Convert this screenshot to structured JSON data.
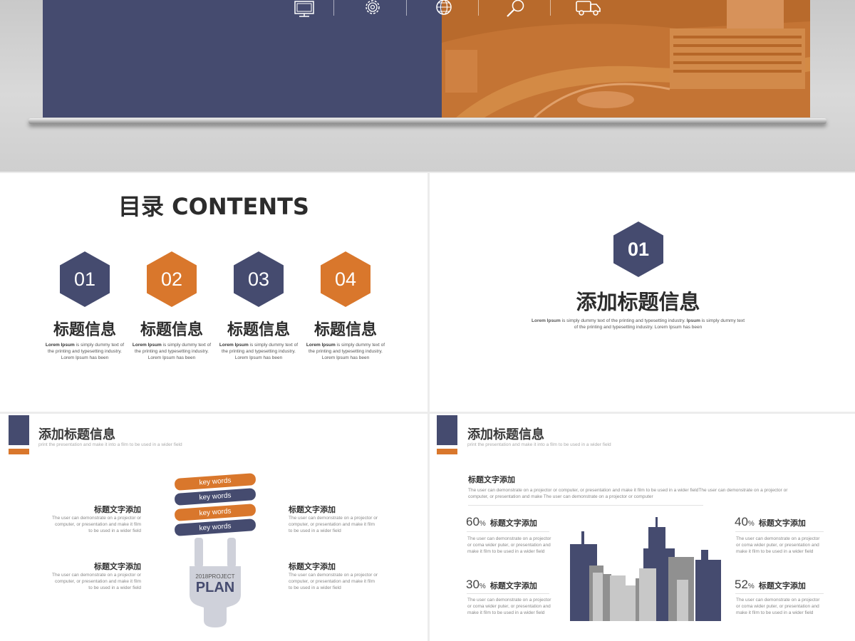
{
  "colors": {
    "navy": "#454b6f",
    "orange": "#d9772c"
  },
  "top_icons": [
    "monitor-icon",
    "gear-icon",
    "globe-icon",
    "magnifier-icon",
    "truck-icon"
  ],
  "contents": {
    "title": "目录 CONTENTS",
    "items": [
      {
        "num": "01",
        "title": "标题信息",
        "desc_bold": "Lorem Ipsum",
        "desc": " is simply dummy text of the printing and typesetting industry. Lorem Ipsum has been"
      },
      {
        "num": "02",
        "title": "标题信息",
        "desc_bold": "Lorem Ipsum",
        "desc": " is simply dummy text of the printing and typesetting industry. Lorem Ipsum has been"
      },
      {
        "num": "03",
        "title": "标题信息",
        "desc_bold": "Lorem Ipsum",
        "desc": " is simply dummy text of the printing and typesetting industry. Lorem Ipsum has been"
      },
      {
        "num": "04",
        "title": "标题信息",
        "desc_bold": "Lorem Ipsum",
        "desc": " is simply dummy text of the printing and typesetting industry. Lorem Ipsum has been"
      }
    ]
  },
  "section": {
    "num": "01",
    "title": "添加标题信息",
    "desc_bold1": "Lorem Ipsum",
    "desc1": " is simply dummy text of the printing and typesetting industry. ",
    "desc_bold2": "Ipsum",
    "desc2": " is simply dummy text of the printing and typesetting industry. Lorem Ipsum has been"
  },
  "slide4": {
    "title": "添加标题信息",
    "subtitle": "print the presentation and make it into a film to be used in a wider field",
    "keywords": [
      "key words",
      "key words",
      "key words",
      "key words"
    ],
    "bulb_year": "2018PROJECT",
    "bulb_plan": "PLAN",
    "blocks": [
      {
        "title": "标题文字添加",
        "text": "The user can demonstrate on a projector or computer, or presentation and make it film to be used in a wider field"
      },
      {
        "title": "标题文字添加",
        "text": "The user can demonstrate on a projector or computer, or presentation and make it film to be used in a wider field"
      },
      {
        "title": "标题文字添加",
        "text": "The user can demonstrate on a projector or computer, or presentation and make it film to be used in a wider field"
      },
      {
        "title": "标题文字添加",
        "text": "The user can demonstrate on a projector or computer, or presentation and make it film to be used in a wider field"
      }
    ]
  },
  "slide5": {
    "title": "添加标题信息",
    "subtitle": "print the presentation and make it into a film to be used in a wider field",
    "lead_title": "标题文字添加",
    "lead_text": "The user can demonstrate on a projector or computer, or presentation and make it film to be used in a wider fieldThe user can demonstrate on a projector or computer, or presentation and make The user can demonstrate on a projector or computer",
    "stats": [
      {
        "value": "60",
        "unit": "%",
        "title": "标题文字添加",
        "text": "The user can demonstrate on a projector or coma wider puter, or presentation and make it film to be used in a wider field"
      },
      {
        "value": "30",
        "unit": "%",
        "title": "标题文字添加",
        "text": "The user can demonstrate on a projector or coma wider puter, or presentation and make it film to be used in a wider field"
      },
      {
        "value": "40",
        "unit": "%",
        "title": "标题文字添加",
        "text": "The user can demonstrate on a projector or coma wider puter, or presentation and make it film to be used in a wider field"
      },
      {
        "value": "52",
        "unit": "%",
        "title": "标题文字添加",
        "text": "The user can demonstrate on a projector or coma wider puter, or presentation and make it film to be used in a wider field"
      }
    ]
  }
}
